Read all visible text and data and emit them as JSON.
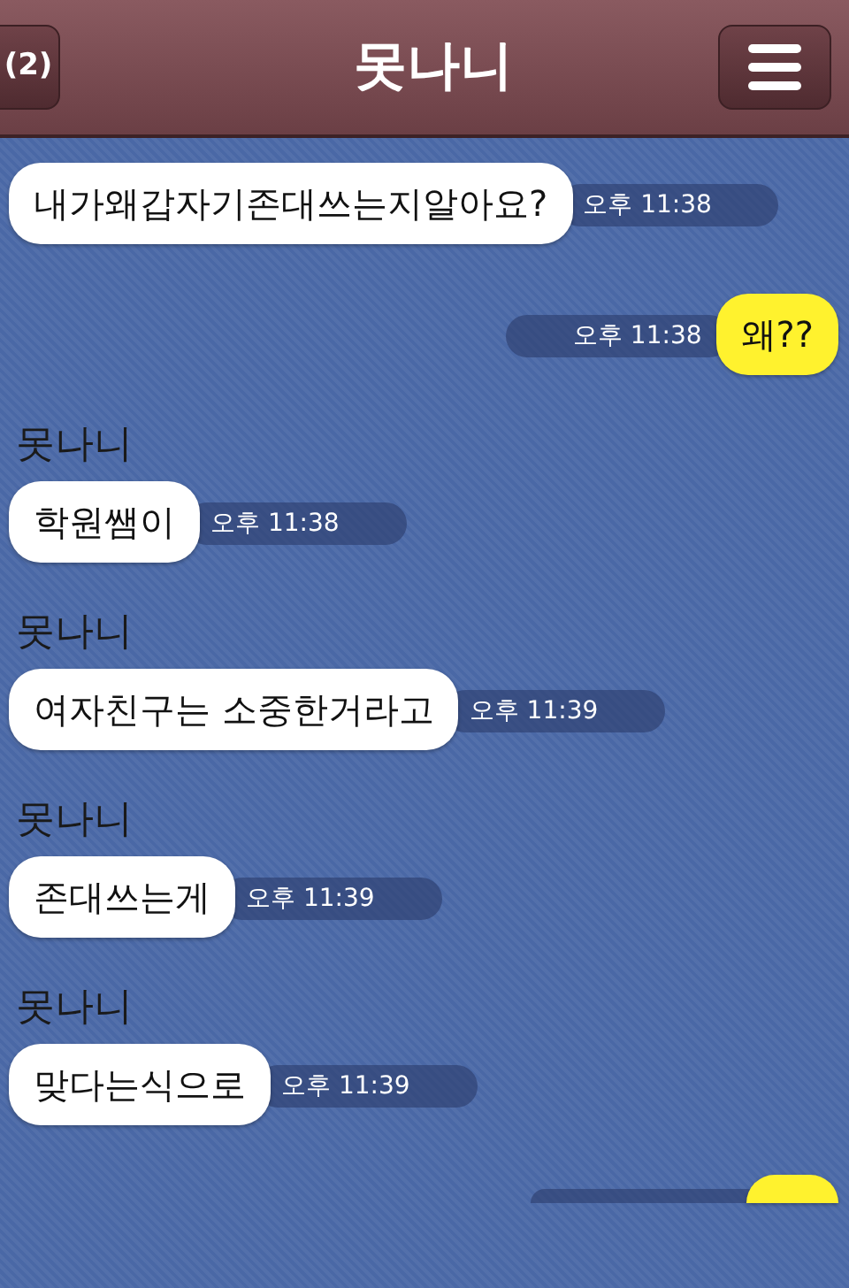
{
  "header": {
    "back_button": "(2)",
    "title": "못나니"
  },
  "messages": [
    {
      "kind": "in",
      "text": "내가왜갑자기존대쓰는지알아요?",
      "time": "오후 11:38"
    },
    {
      "kind": "out",
      "text": "왜??",
      "time": "오후 11:38"
    },
    {
      "kind": "in",
      "sender": "못나니",
      "text": "학원쌤이",
      "time": "오후 11:38"
    },
    {
      "kind": "in",
      "sender": "못나니",
      "text": "여자친구는 소중한거라고",
      "time": "오후 11:39"
    },
    {
      "kind": "in",
      "sender": "못나니",
      "text": "존대쓰는게",
      "time": "오후 11:39"
    },
    {
      "kind": "in",
      "sender": "못나니",
      "text": "맞다는식으로",
      "time": "오후 11:39"
    },
    {
      "kind": "out_cut"
    }
  ]
}
